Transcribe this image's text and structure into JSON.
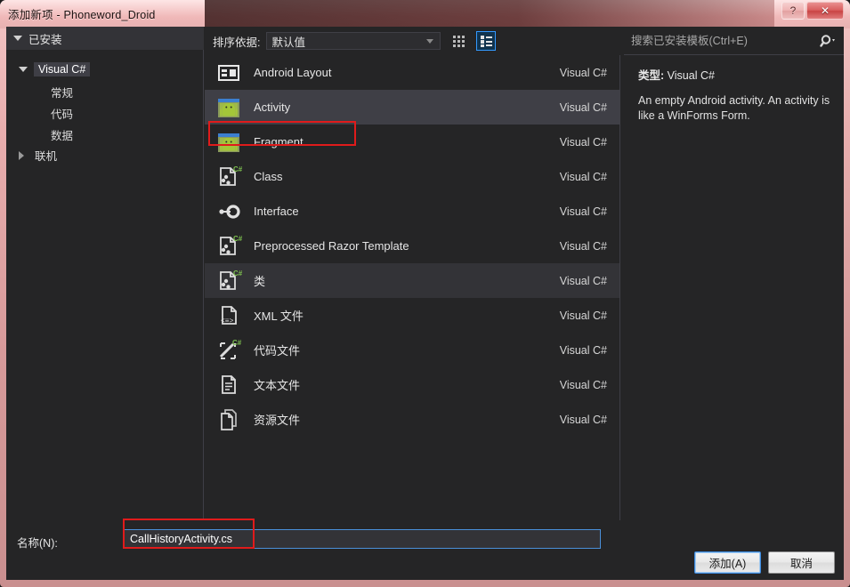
{
  "window": {
    "title": "添加新项 - Phoneword_Droid",
    "help_button": "?",
    "close_button": "✕"
  },
  "sidebar": {
    "header": "已安装",
    "root": {
      "label": "Visual C#",
      "selected": true
    },
    "children": [
      {
        "label": "常规"
      },
      {
        "label": "代码"
      },
      {
        "label": "数据"
      }
    ],
    "online": {
      "label": "联机"
    }
  },
  "toolbar": {
    "sort_label": "排序依据:",
    "sort_value": "默认值",
    "grid_view_icon": "grid-view-icon",
    "list_view_icon": "list-view-icon",
    "list_view_active": true
  },
  "templates": {
    "lang_column": "Visual C#",
    "items": [
      {
        "name": "Android Layout",
        "lang": "Visual C#",
        "icon": "android-layout-icon",
        "state": "normal"
      },
      {
        "name": "Activity",
        "lang": "Visual C#",
        "icon": "android-activity-icon",
        "state": "selected"
      },
      {
        "name": "Fragment",
        "lang": "Visual C#",
        "icon": "android-fragment-icon",
        "state": "normal"
      },
      {
        "name": "Class",
        "lang": "Visual C#",
        "icon": "csharp-class-icon",
        "state": "normal"
      },
      {
        "name": "Interface",
        "lang": "Visual C#",
        "icon": "interface-icon",
        "state": "normal"
      },
      {
        "name": "Preprocessed Razor Template",
        "lang": "Visual C#",
        "icon": "csharp-class-icon",
        "state": "normal"
      },
      {
        "name": "类",
        "lang": "Visual C#",
        "icon": "csharp-class-icon",
        "state": "hovered"
      },
      {
        "name": "XML 文件",
        "lang": "Visual C#",
        "icon": "xml-file-icon",
        "state": "normal"
      },
      {
        "name": "代码文件",
        "lang": "Visual C#",
        "icon": "code-file-icon",
        "state": "normal"
      },
      {
        "name": "文本文件",
        "lang": "Visual C#",
        "icon": "text-file-icon",
        "state": "normal"
      },
      {
        "name": "资源文件",
        "lang": "Visual C#",
        "icon": "resource-file-icon",
        "state": "normal"
      }
    ]
  },
  "search": {
    "placeholder": "搜索已安装模板(Ctrl+E)",
    "value": "",
    "icon": "search-icon"
  },
  "details": {
    "type_label": "类型:",
    "type_value": "Visual C#",
    "description": "An empty Android activity.  An activity is like a WinForms Form."
  },
  "name_field": {
    "label": "名称(N):",
    "value": "CallHistoryActivity.cs"
  },
  "buttons": {
    "add": "添加(A)",
    "add_accel": "A",
    "cancel": "取消"
  },
  "colors": {
    "frame": "#e8aeae",
    "dialog_bg": "#252526",
    "selection": "#3f3f46",
    "hover": "#333337",
    "accent_blue": "#3399ff",
    "annotation_red": "#e01b1b",
    "android_green": "#a4c639"
  }
}
